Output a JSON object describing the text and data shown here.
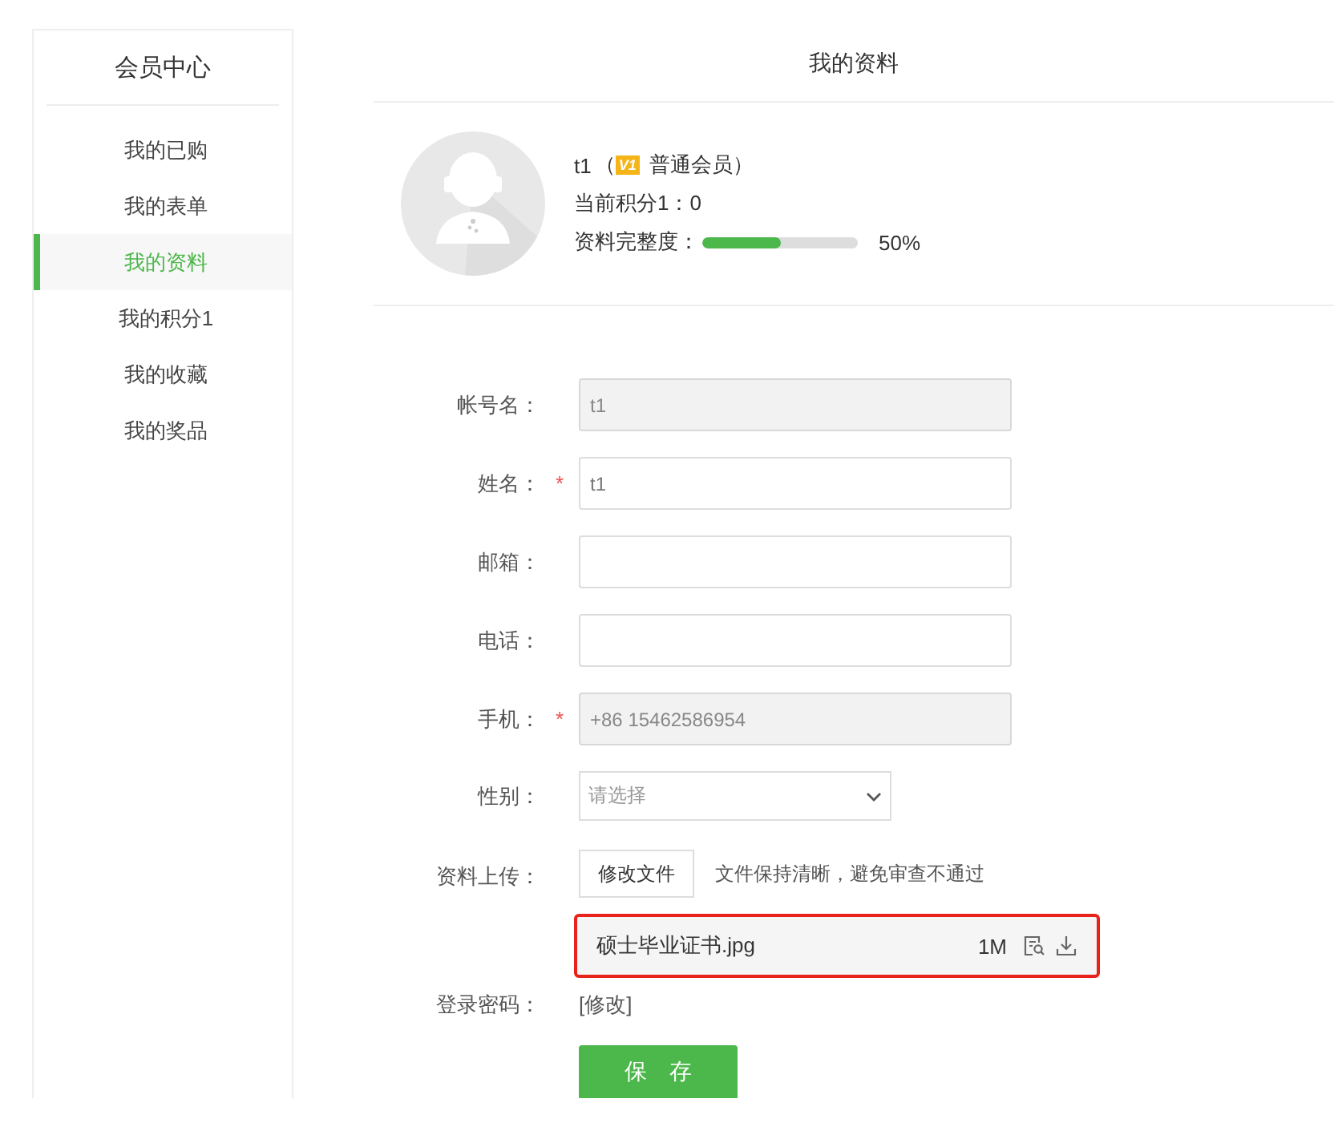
{
  "sidebar": {
    "title": "会员中心",
    "items": [
      {
        "label": "我的已购",
        "selected": false
      },
      {
        "label": "我的表单",
        "selected": false
      },
      {
        "label": "我的资料",
        "selected": true
      },
      {
        "label": "我的积分1",
        "selected": false
      },
      {
        "label": "我的收藏",
        "selected": false
      },
      {
        "label": "我的奖品",
        "selected": false
      }
    ]
  },
  "page_title": "我的资料",
  "profile": {
    "username": "t1",
    "open_paren": "（",
    "badge": "V1",
    "member_level": "普通会员）",
    "points": "当前积分1：0",
    "completeness_label": "资料完整度：",
    "level": 0.5,
    "percent": "50%"
  },
  "form": {
    "fields": [
      {
        "kind": "input",
        "label": "帐号名：",
        "disabled": true,
        "value": "t1"
      },
      {
        "kind": "input",
        "label": "姓名：",
        "required_mark": "*",
        "disabled": false,
        "value": "t1"
      },
      {
        "kind": "input",
        "label": "邮箱：",
        "disabled": false
      },
      {
        "kind": "input",
        "label": "电话：",
        "disabled": false
      },
      {
        "kind": "input",
        "label": "手机：",
        "required_mark": "*",
        "disabled": true,
        "value": "+86 15462586954"
      },
      {
        "kind": "select",
        "label": "性别：",
        "placeholder": "请选择"
      },
      {
        "kind": "upload",
        "label": "资料上传：",
        "button": "修改文件",
        "hint": "文件保持清晰，避免审查不通过",
        "file": {
          "name": "硕士毕业证书.jpg",
          "size": "1M"
        }
      },
      {
        "kind": "password",
        "label": "登录密码：",
        "link": "[修改]"
      }
    ],
    "save": "保　存"
  }
}
